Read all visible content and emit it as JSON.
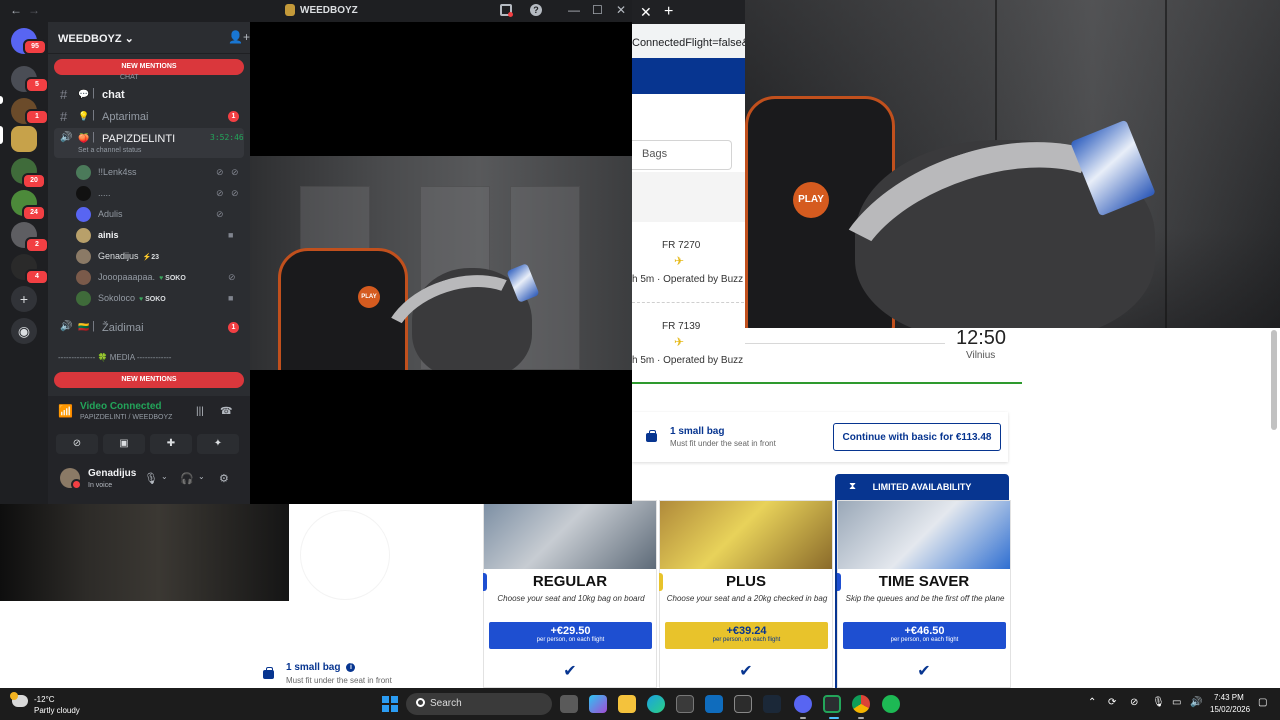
{
  "discord": {
    "title": "WEEDBOYZ",
    "server_name": "WEEDBOYZ",
    "new_mentions": "NEW MENTIONS",
    "servers": [
      {
        "badge": "95"
      },
      {
        "badge": "5"
      },
      {
        "badge": "1"
      },
      {
        "badge": ""
      },
      {
        "badge": "20"
      },
      {
        "badge": "24"
      },
      {
        "badge": "2"
      },
      {
        "badge": "4"
      }
    ],
    "channels": {
      "chat_label": "CHAT",
      "chat": "chat",
      "aptarimai": "Aptarimai",
      "aptarimai_badge": "1",
      "voice_channel": "PAPIZDELINTI",
      "voice_timer": "3:52:46",
      "channel_status": "Set a channel status",
      "zaidimai": "Žaidimai",
      "zaidimai_badge": "1",
      "media_category": "-------------- 🍀 MEDIA -------------"
    },
    "members": [
      {
        "name": "!!Lenk4ss",
        "tag": ""
      },
      {
        "name": ".....",
        "tag": ""
      },
      {
        "name": "Adulis",
        "tag": ""
      },
      {
        "name": "ainis",
        "tag": ""
      },
      {
        "name": "Genadijus",
        "tag": "23"
      },
      {
        "name": "Jooopaaapaa.",
        "tag": "SOKO"
      },
      {
        "name": "Sokoloco",
        "tag": "SOKO"
      }
    ],
    "voice_panel": {
      "status": "Video Connected",
      "location": "PAPIZDELINTI / WEEDBOYZ"
    },
    "user": {
      "name": "Genadijus",
      "status": "In voice"
    }
  },
  "browser": {
    "url_fragment": "ConnectedFlight=false&dis",
    "bags_tab": "Bags",
    "flights": [
      {
        "number": "FR 7270",
        "duration": "h 5m · Operated by Buzz"
      },
      {
        "number": "FR 7139",
        "duration": "h 5m · Operated by Buzz"
      }
    ],
    "arrival_time": "12:50",
    "arrival_city": "Vilnius",
    "small_bag": {
      "title": "1 small bag",
      "subtitle": "Must fit under the seat in front"
    },
    "continue_button": "Continue with basic for €113.48",
    "limited_availability": "LIMITED AVAILABILITY",
    "fares": [
      {
        "name": "REGULAR",
        "desc": "Choose your seat and 10kg bag on board",
        "price": "+€29.50",
        "per": "per person, on each flight",
        "color": "#1e4fd1"
      },
      {
        "name": "PLUS",
        "desc": "Choose your seat and a 20kg checked in bag",
        "price": "+€39.24",
        "per": "per person, on each flight",
        "color": "#e8c32b"
      },
      {
        "name": "TIME SAVER",
        "desc": "Skip the queues and be the first off the plane",
        "price": "+€46.50",
        "per": "per person, on each flight",
        "color": "#1e4fd1"
      }
    ]
  },
  "taskbar": {
    "temp": "-12°C",
    "weather": "Partly cloudy",
    "search": "Search",
    "time": "7:43 PM",
    "date": "15/02/2026"
  },
  "colors": {
    "ryanair_blue": "#073590",
    "discord_green": "#23a55a",
    "mention_red": "#da373c"
  }
}
